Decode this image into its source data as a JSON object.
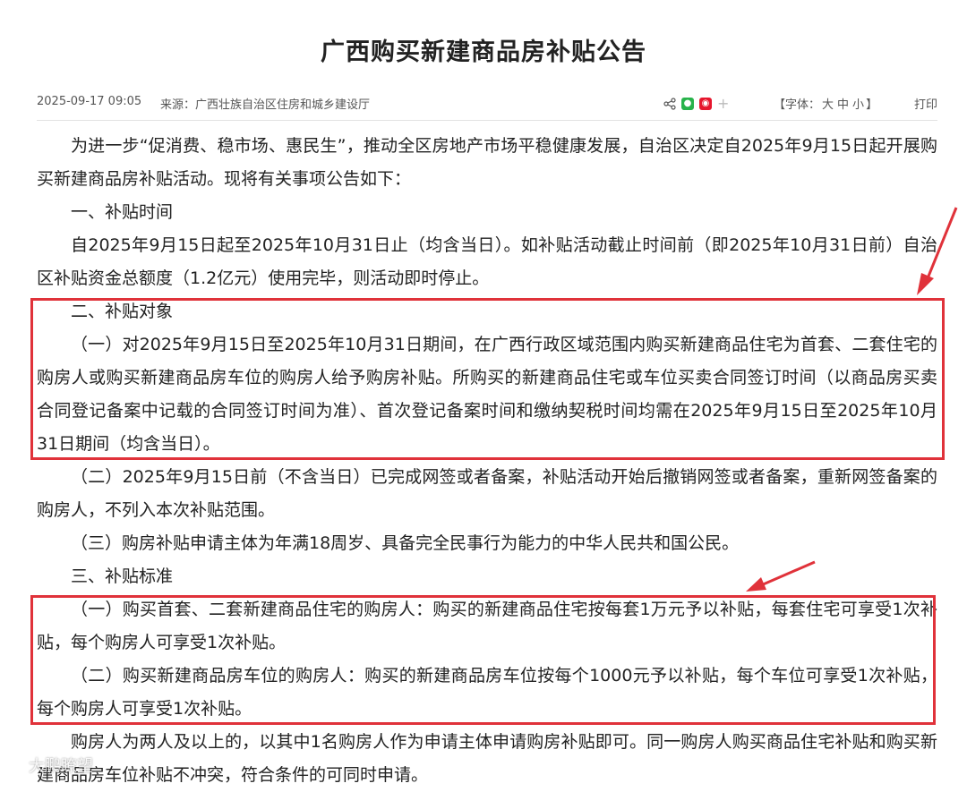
{
  "article": {
    "title": "广西购买新建商品房补贴公告",
    "date": "2025-09-17 09:05",
    "source": "来源：广西壮族自治区住房和城乡建设厅",
    "font_size_label": "【字体：",
    "font_sizes": [
      "大",
      "中",
      "小"
    ],
    "font_size_end": "】",
    "print_label": "打印",
    "share_icons": [
      "share-icon",
      "wechat-icon",
      "weibo-icon",
      "plus-icon"
    ],
    "paragraphs": [
      "为进一步“促消费、稳市场、惠民生”，推动全区房地产市场平稳健康发展，自治区决定自2025年9月15日起开展购买新建商品房补贴活动。现将有关事项公告如下：",
      "一、补贴时间",
      "自2025年9月15日起至2025年10月31日止（均含当日）。如补贴活动截止时间前（即2025年10月31日前）自治区补贴资金总额度（1.2亿元）使用完毕，则活动即时停止。",
      "二、补贴对象",
      "（一）对2025年9月15日至2025年10月31日期间，在广西行政区域范围内购买新建商品住宅为首套、二套住宅的购房人或购买新建商品房车位的购房人给予购房补贴。所购买的新建商品住宅或车位买卖合同签订时间（以商品房买卖合同登记备案中记载的合同签订时间为准）、首次登记备案时间和缴纳契税时间均需在2025年9月15日至2025年10月31日期间（均含当日）。",
      "（二）2025年9月15日前（不含当日）已完成网签或者备案，补贴活动开始后撤销网签或者备案，重新网签备案的购房人，不列入本次补贴范围。",
      "（三）购房补贴申请主体为年满18周岁、具备完全民事行为能力的中华人民共和国公民。",
      "三、补贴标准",
      "（一）购买首套、二套新建商品住宅的购房人：购买的新建商品住宅按每套1万元予以补贴，每套住宅可享受1次补贴，每个购房人可享受1次补贴。",
      "（二）购买新建商品房车位的购房人：购买的新建商品房车位按每个1000元予以补贴，每个车位可享受1次补贴，每个购房人可享受1次补贴。",
      "购房人为两人及以上的，以其中1名购房人作为申请主体申请购房补贴即可。同一购房人购买商品住宅补贴和购买新建商品房车位补贴不冲突，符合条件的可同时申请。"
    ]
  },
  "annotations": {
    "color": "#e0323a"
  },
  "watermark": {
    "text": "大鹏瞭望",
    "icon": "weibo-logo-icon"
  }
}
